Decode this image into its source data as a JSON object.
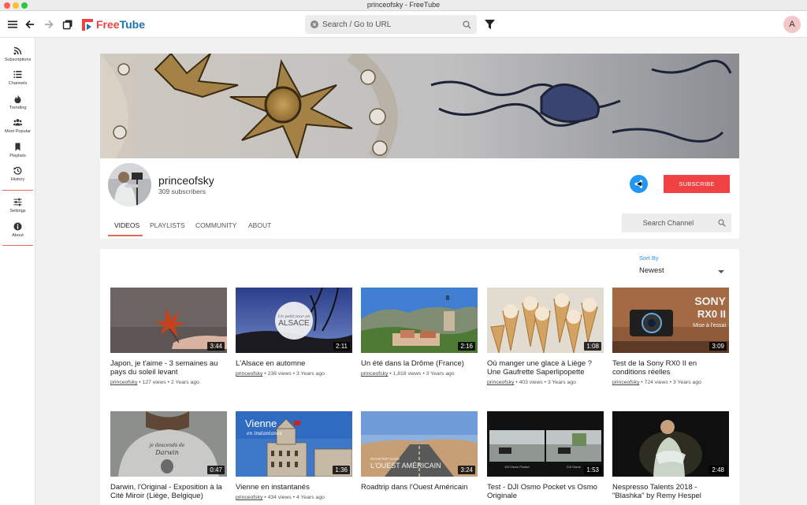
{
  "window": {
    "title": "princeofsky - FreeTube"
  },
  "app": {
    "logo_free": "Free",
    "logo_tube": "Tube"
  },
  "search": {
    "placeholder": "Search / Go to URL"
  },
  "user": {
    "avatar_letter": "A"
  },
  "sidebar": {
    "items": [
      {
        "label": "Subscriptions",
        "icon": "rss-icon"
      },
      {
        "label": "Channels",
        "icon": "list-icon"
      },
      {
        "label": "Trending",
        "icon": "fire-icon"
      },
      {
        "label": "Most Popular",
        "icon": "users-icon"
      },
      {
        "label": "Playlists",
        "icon": "bookmark-icon"
      },
      {
        "label": "History",
        "icon": "history-icon"
      },
      {
        "label": "Settings",
        "icon": "sliders-icon"
      },
      {
        "label": "About",
        "icon": "info-icon"
      }
    ]
  },
  "channel": {
    "name": "princeofsky",
    "subscribers": "309 subscribers",
    "subscribe_label": "SUBSCRIBE",
    "search_placeholder": "Search Channel",
    "tabs": [
      {
        "label": "VIDEOS",
        "active": true
      },
      {
        "label": "PLAYLISTS",
        "active": false
      },
      {
        "label": "COMMUNITY",
        "active": false
      },
      {
        "label": "ABOUT",
        "active": false
      }
    ]
  },
  "sort": {
    "label": "Sort By",
    "value": "Newest"
  },
  "videos": [
    {
      "title": "Japon, je t'aime - 3 semaines au pays du soleil levant",
      "duration": "3:44",
      "uploader": "princeofsky",
      "views": "127 views",
      "age": "2 Years ago"
    },
    {
      "title": "L'Alsace en automne",
      "duration": "2:11",
      "uploader": "princeofsky",
      "views": "238 views",
      "age": "3 Years ago",
      "thumb_text_small": "Un petit tour en",
      "thumb_text_big": "ALSACE"
    },
    {
      "title": "Un été dans la Drôme (France)",
      "duration": "2:16",
      "uploader": "princeofsky",
      "views": "1,818 views",
      "age": "3 Years ago"
    },
    {
      "title": "Où manger une glace à Liège ? Une Gaufrette Saperlipopette",
      "duration": "1:08",
      "uploader": "princeofsky",
      "views": "403 views",
      "age": "3 Years ago"
    },
    {
      "title": "Test de la Sony RX0 II en conditions réelles",
      "duration": "3:09",
      "uploader": "princeofsky",
      "views": "724 views",
      "age": "3 Years ago",
      "thumb_text_big": "SONY",
      "thumb_text_model": "RX0 II",
      "thumb_text_small": "Mise à l'essai"
    },
    {
      "title": "Darwin, l'Original - Exposition à la Cité Miroir (Liège, Belgique)",
      "duration": "0:47",
      "uploader": "",
      "views": "",
      "age": "",
      "thumb_text_small": "je descends de",
      "thumb_text_big": "Darwin"
    },
    {
      "title": "Vienne en instantanés",
      "duration": "1:36",
      "uploader": "princeofsky",
      "views": "434 views",
      "age": "4 Years ago",
      "thumb_text_big": "Vienne",
      "thumb_text_small": "en instantanés"
    },
    {
      "title": "Roadtrip dans l'Ouest Américain",
      "duration": "3:24",
      "uploader": "",
      "views": "",
      "age": "",
      "thumb_text_small": "ROADTRIP DANS",
      "thumb_text_big": "L'OUEST AMÉRICAIN"
    },
    {
      "title": "Test - DJI Osmo Pocket vs Osmo Originale",
      "duration": "1:53",
      "uploader": "",
      "views": "",
      "age": "",
      "thumb_text_left": "DJI Osmo Pocket",
      "thumb_text_right": "DJI Osmo"
    },
    {
      "title": "Nespresso Talents 2018 - \"Blashka\" by Remy Hespel",
      "duration": "2:48",
      "uploader": "",
      "views": "",
      "age": ""
    }
  ],
  "colors": {
    "accent": "#e26a5a",
    "brand_red": "#f04242",
    "brand_blue": "#1a73b8",
    "share_blue": "#2196f3"
  }
}
